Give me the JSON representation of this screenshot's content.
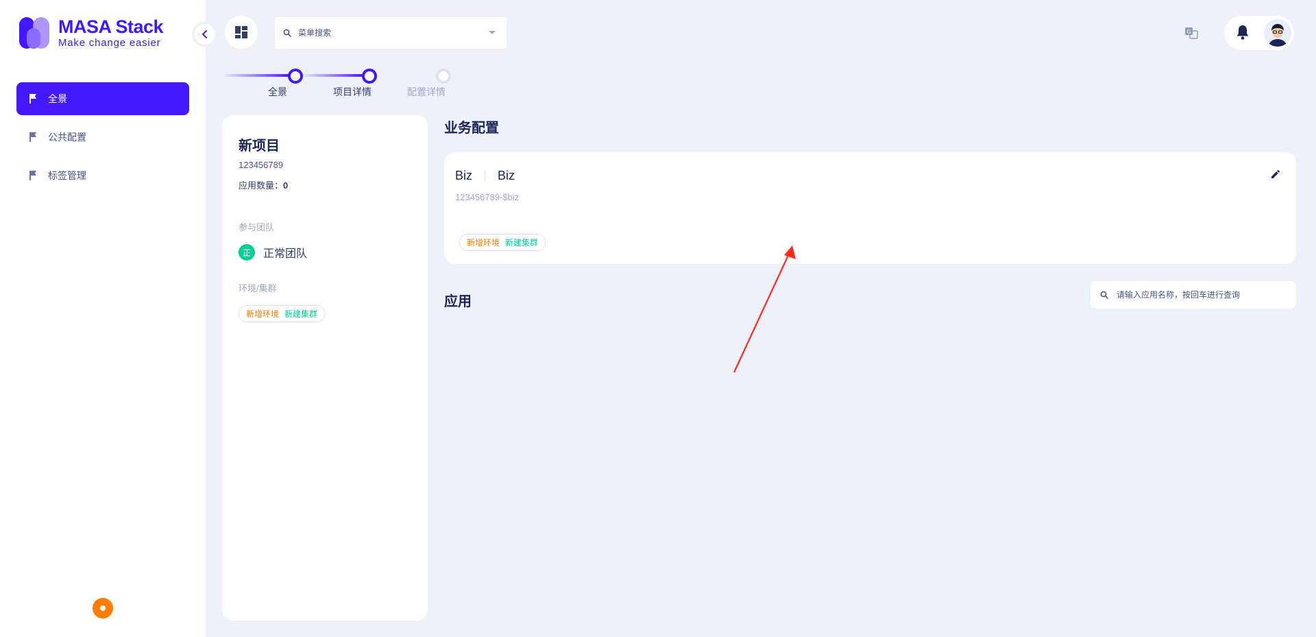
{
  "brand": {
    "title": "MASA Stack",
    "subtitle": "Make change easier"
  },
  "sidebar": {
    "items": [
      {
        "label": "全景",
        "active": true,
        "icon": "flag-icon"
      },
      {
        "label": "公共配置",
        "active": false,
        "icon": "flag-icon"
      },
      {
        "label": "标签管理",
        "active": false,
        "icon": "flag-icon"
      }
    ]
  },
  "topbar": {
    "menu_search_placeholder": "菜单搜索"
  },
  "steps": [
    {
      "label": "全景",
      "done": true
    },
    {
      "label": "项目详情",
      "done": true
    },
    {
      "label": "配置详情",
      "done": false
    }
  ],
  "project": {
    "name": "新项目",
    "id": "123456789",
    "app_count_label": "应用数量：",
    "app_count": "0",
    "team_section": "参与团队",
    "team_badge": "正",
    "team_name": "正常团队",
    "env_section": "环境/集群",
    "env_chip_add": "新增环境",
    "env_chip_new": "新建集群"
  },
  "business": {
    "title": "业务配置",
    "card": {
      "name": "Biz",
      "identity": "Biz",
      "id": "123456789-$biz",
      "chip_add": "新增环境",
      "chip_new": "新建集群"
    }
  },
  "apps": {
    "title": "应用",
    "search_placeholder": "请输入应用名称，按回车进行查询"
  },
  "colors": {
    "primary": "#4318ff",
    "orange": "#ff7d00",
    "green": "#05cd99",
    "annotation": "#ff2a1a"
  }
}
